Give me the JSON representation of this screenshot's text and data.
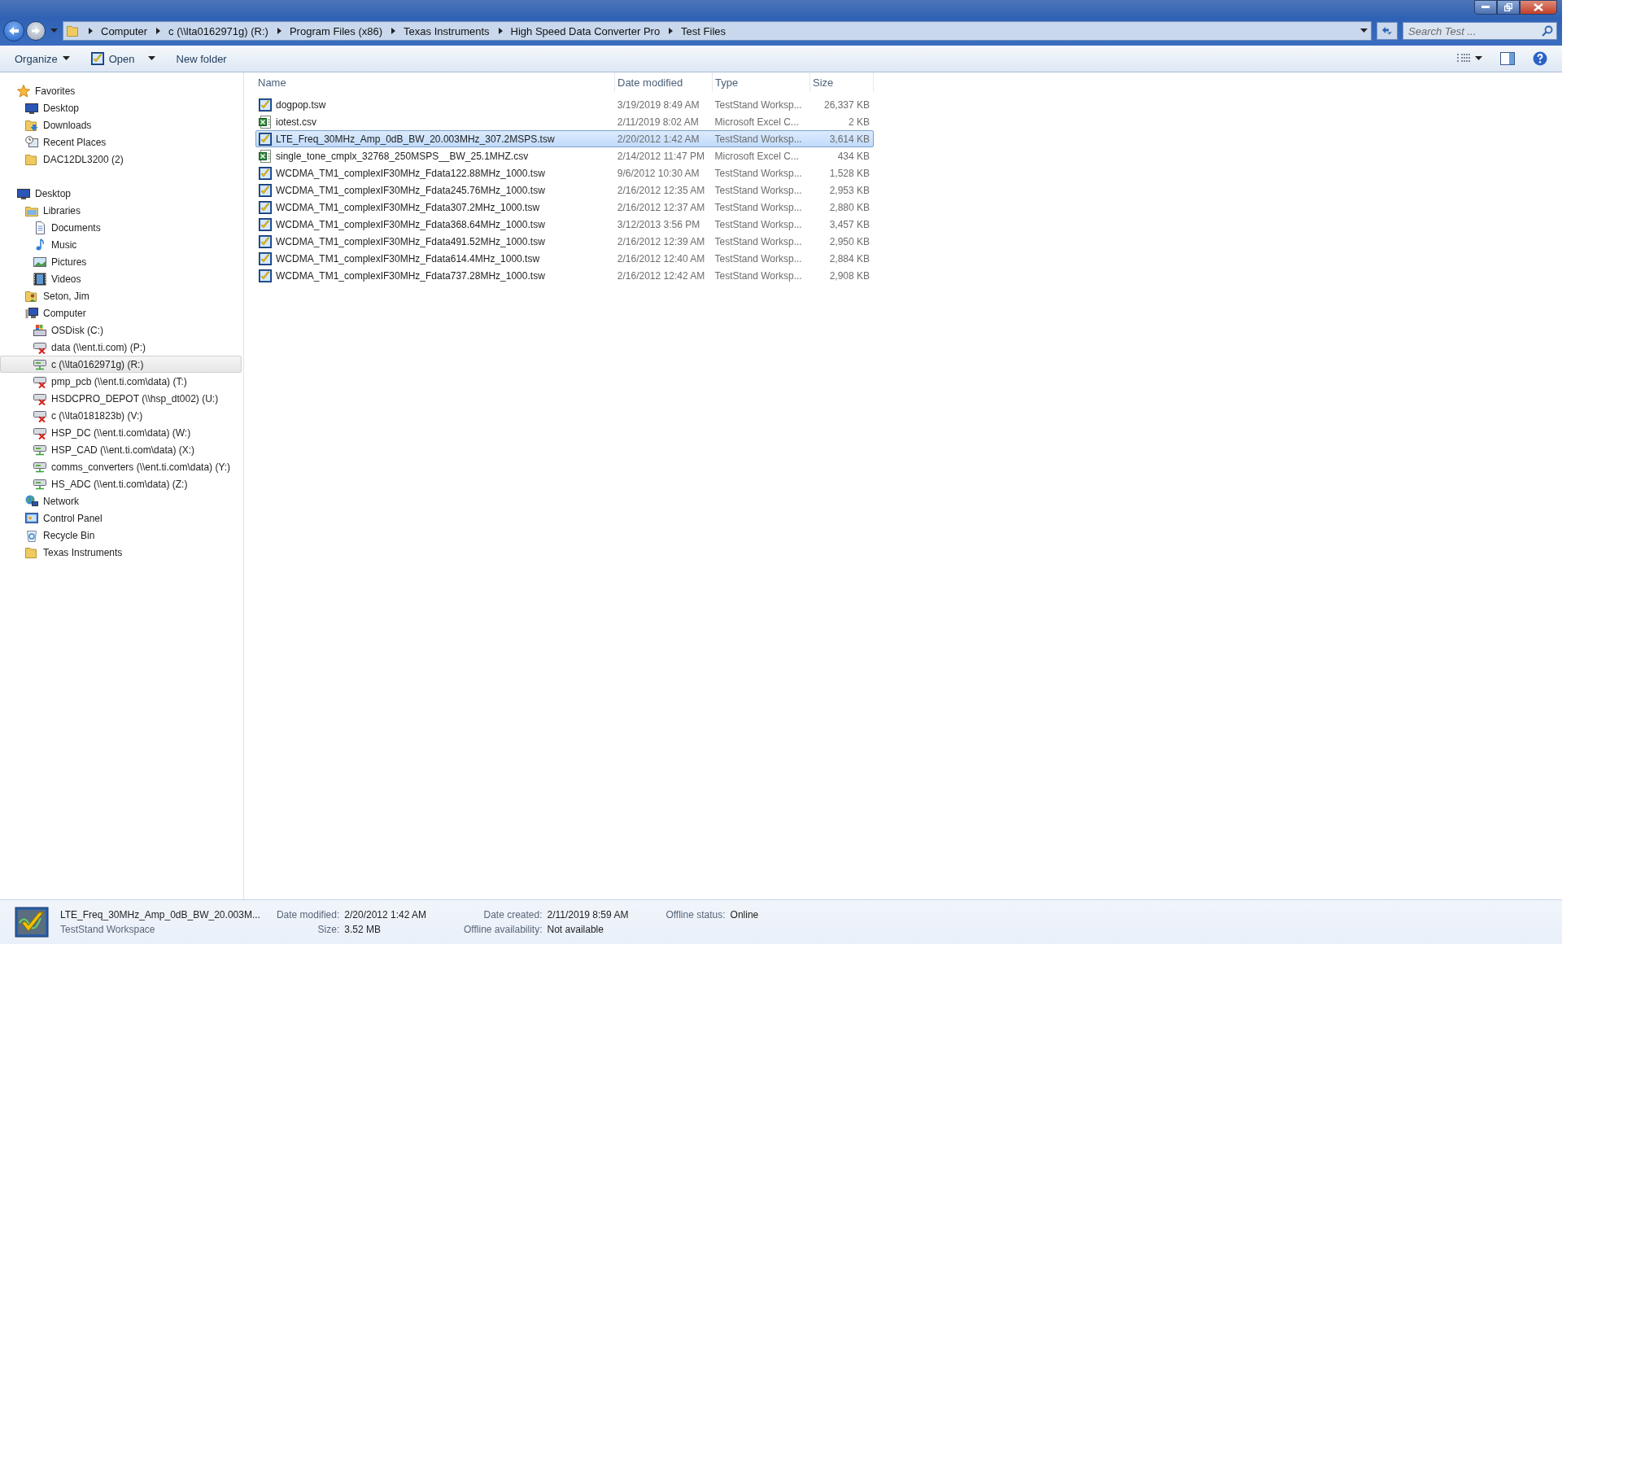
{
  "address_bar": {
    "segments": [
      "Computer",
      "c (\\\\lta0162971g) (R:)",
      "Program Files (x86)",
      "Texas Instruments",
      "High Speed Data Converter Pro",
      "Test Files"
    ]
  },
  "search": {
    "placeholder": "Search Test ..."
  },
  "toolbar": {
    "items": [
      {
        "label": "Organize",
        "kind": "menu"
      },
      {
        "label": "Open",
        "kind": "open"
      },
      {
        "label": "New folder",
        "kind": "plain"
      }
    ]
  },
  "sidebar": {
    "groups": [
      {
        "label": "Favorites",
        "kind": "star",
        "children": [
          {
            "label": "Desktop",
            "kind": "desktop"
          },
          {
            "label": "Downloads",
            "kind": "downloads"
          },
          {
            "label": "Recent Places",
            "kind": "recent"
          },
          {
            "label": "DAC12DL3200 (2)",
            "kind": "folder"
          }
        ]
      },
      {
        "label": "Desktop",
        "kind": "desktop",
        "children": [
          {
            "label": "Libraries",
            "kind": "library",
            "children": [
              {
                "label": "Documents",
                "kind": "document"
              },
              {
                "label": "Music",
                "kind": "music"
              },
              {
                "label": "Pictures",
                "kind": "pictures"
              },
              {
                "label": "Videos",
                "kind": "videos"
              }
            ]
          },
          {
            "label": "Seton, Jim",
            "kind": "user"
          },
          {
            "label": "Computer",
            "kind": "computer",
            "children": [
              {
                "label": "OSDisk (C:)",
                "kind": "disk"
              },
              {
                "label": "data (\\\\ent.ti.com) (P:)",
                "kind": "network-drive",
                "connected": false,
                "selected": false
              },
              {
                "label": "c (\\\\lta0162971g) (R:)",
                "kind": "network-drive",
                "connected": true,
                "selected": true
              },
              {
                "label": "pmp_pcb (\\\\ent.ti.com\\data) (T:)",
                "kind": "network-drive",
                "connected": false,
                "selected": false
              },
              {
                "label": "HSDCPRO_DEPOT (\\\\hsp_dt002) (U:)",
                "kind": "network-drive",
                "connected": false,
                "selected": false
              },
              {
                "label": "c (\\\\lta0181823b) (V:)",
                "kind": "network-drive",
                "connected": false,
                "selected": false
              },
              {
                "label": "HSP_DC (\\\\ent.ti.com\\data) (W:)",
                "kind": "network-drive",
                "connected": false,
                "selected": false
              },
              {
                "label": "HSP_CAD (\\\\ent.ti.com\\data) (X:)",
                "kind": "network-drive",
                "connected": true,
                "selected": false
              },
              {
                "label": "comms_converters (\\\\ent.ti.com\\data) (Y:)",
                "kind": "network-drive",
                "connected": true,
                "selected": false
              },
              {
                "label": "HS_ADC (\\\\ent.ti.com\\data) (Z:)",
                "kind": "network-drive",
                "connected": true,
                "selected": false
              }
            ]
          },
          {
            "label": "Network",
            "kind": "network"
          },
          {
            "label": "Control Panel",
            "kind": "control-panel"
          },
          {
            "label": "Recycle Bin",
            "kind": "recycle"
          },
          {
            "label": "Texas Instruments",
            "kind": "folder"
          }
        ]
      }
    ]
  },
  "file_list": {
    "columns": [
      "Name",
      "Date modified",
      "Type",
      "Size"
    ],
    "rows": [
      {
        "name": "dogpop.tsw",
        "date": "3/19/2019 8:49 AM",
        "type": "TestStand Worksp...",
        "size": "26,337 KB",
        "kind": "tsw",
        "selected": false
      },
      {
        "name": "iotest.csv",
        "date": "2/11/2019 8:02 AM",
        "type": "Microsoft Excel C...",
        "size": "2 KB",
        "kind": "csv",
        "selected": false
      },
      {
        "name": "LTE_Freq_30MHz_Amp_0dB_BW_20.003MHz_307.2MSPS.tsw",
        "date": "2/20/2012 1:42 AM",
        "type": "TestStand Worksp...",
        "size": "3,614 KB",
        "kind": "tsw",
        "selected": true
      },
      {
        "name": "single_tone_cmplx_32768_250MSPS__BW_25.1MHZ.csv",
        "date": "2/14/2012 11:47 PM",
        "type": "Microsoft Excel C...",
        "size": "434 KB",
        "kind": "csv",
        "selected": false
      },
      {
        "name": "WCDMA_TM1_complexIF30MHz_Fdata122.88MHz_1000.tsw",
        "date": "9/6/2012 10:30 AM",
        "type": "TestStand Worksp...",
        "size": "1,528 KB",
        "kind": "tsw",
        "selected": false
      },
      {
        "name": "WCDMA_TM1_complexIF30MHz_Fdata245.76MHz_1000.tsw",
        "date": "2/16/2012 12:35 AM",
        "type": "TestStand Worksp...",
        "size": "2,953 KB",
        "kind": "tsw",
        "selected": false
      },
      {
        "name": "WCDMA_TM1_complexIF30MHz_Fdata307.2MHz_1000.tsw",
        "date": "2/16/2012 12:37 AM",
        "type": "TestStand Worksp...",
        "size": "2,880 KB",
        "kind": "tsw",
        "selected": false
      },
      {
        "name": "WCDMA_TM1_complexIF30MHz_Fdata368.64MHz_1000.tsw",
        "date": "3/12/2013 3:56 PM",
        "type": "TestStand Worksp...",
        "size": "3,457 KB",
        "kind": "tsw",
        "selected": false
      },
      {
        "name": "WCDMA_TM1_complexIF30MHz_Fdata491.52MHz_1000.tsw",
        "date": "2/16/2012 12:39 AM",
        "type": "TestStand Worksp...",
        "size": "2,950 KB",
        "kind": "tsw",
        "selected": false
      },
      {
        "name": "WCDMA_TM1_complexIF30MHz_Fdata614.4MHz_1000.tsw",
        "date": "2/16/2012 12:40 AM",
        "type": "TestStand Worksp...",
        "size": "2,884 KB",
        "kind": "tsw",
        "selected": false
      },
      {
        "name": "WCDMA_TM1_complexIF30MHz_Fdata737.28MHz_1000.tsw",
        "date": "2/16/2012 12:42 AM",
        "type": "TestStand Worksp...",
        "size": "2,908 KB",
        "kind": "tsw",
        "selected": false
      }
    ]
  },
  "details_pane": {
    "name": "LTE_Freq_30MHz_Amp_0dB_BW_20.003M...",
    "type": "TestStand Workspace",
    "fields": [
      {
        "label": "Date modified:",
        "value": "2/20/2012 1:42 AM"
      },
      {
        "label": "Date created:",
        "value": "2/11/2019 8:59 AM"
      },
      {
        "label": "Offline status:",
        "value": "Online"
      },
      {
        "label": "Size:",
        "value": "3.52 MB"
      },
      {
        "label": "Offline availability:",
        "value": "Not available"
      }
    ]
  }
}
